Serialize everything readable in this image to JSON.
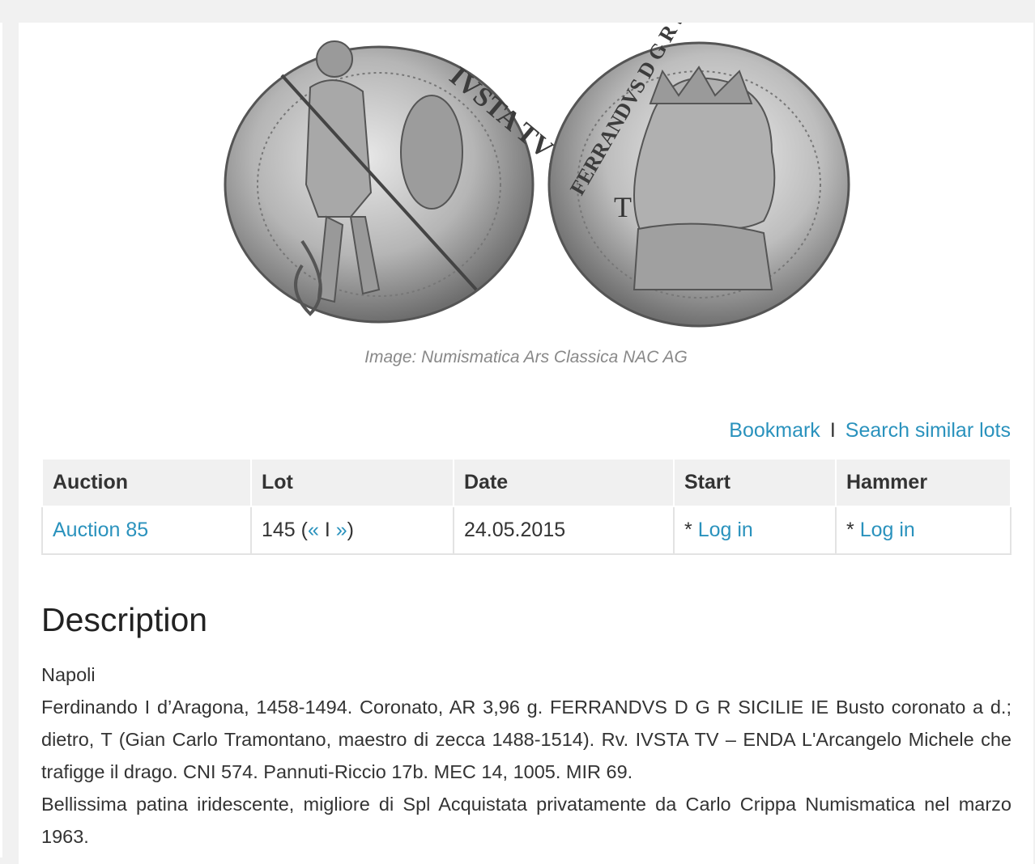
{
  "image": {
    "caption": "Image: Numismatica Ars Classica NAC AG",
    "coin_obverse_legend": "IVSTA TV ENDA",
    "coin_reverse_legend": "FERRANDVS D G R SICILIE IE",
    "coin_reverse_mark": "T"
  },
  "actions": {
    "bookmark": "Bookmark",
    "separator": "I",
    "search_similar": "Search similar lots"
  },
  "lot_table": {
    "headers": [
      "Auction",
      "Lot",
      "Date",
      "Start",
      "Hammer"
    ],
    "row": {
      "auction": "Auction 85",
      "lot_number": "145 (",
      "prev": "«",
      "lot_sep": " I ",
      "next": "»",
      "lot_close": ")",
      "date": "24.05.2015",
      "start_prefix": "* ",
      "start_link": "Log in",
      "hammer_prefix": "* ",
      "hammer_link": "Log in"
    }
  },
  "description": {
    "title": "Description",
    "lines": [
      "Napoli",
      "Ferdinando I d’Aragona, 1458-1494. Coronato, AR 3,96 g. FERRANDVS D G R SICILIE IE Busto coronato a d.; dietro, T (Gian Carlo Tramontano, maestro di zecca 1488-1514). Rv. IVSTA TV – ENDA L'Arcangelo Michele che trafigge il drago. CNI 574. Pannuti-Riccio 17b. MEC 14, 1005. MIR 69.",
      "Bellissima patina iridescente, migliore di Spl Acquistata privatamente da Carlo Crippa Numismatica nel marzo 1963."
    ]
  },
  "colors": {
    "link": "#2a92bd",
    "header_bg": "#f0f0f0",
    "page_bg": "#f1f1f1"
  }
}
